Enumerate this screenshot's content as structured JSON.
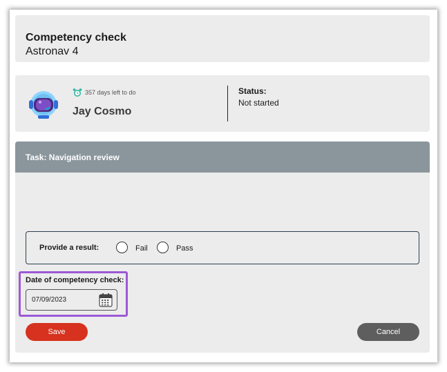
{
  "header": {
    "title": "Competency check",
    "subtitle": "Astronav 4"
  },
  "user": {
    "avatar_icon": "astronaut-helmet-icon",
    "due_icon": "alarm-clock-icon",
    "due_text": "357 days left to do",
    "name": "Jay Cosmo",
    "status_label": "Status:",
    "status_value": "Not started"
  },
  "task": {
    "title": "Task: Navigation review",
    "result_label": "Provide a result:",
    "options": [
      {
        "label": "Fail",
        "selected": false
      },
      {
        "label": "Pass",
        "selected": false
      }
    ],
    "date_label": "Date of competency check:",
    "date_value": "07/09/2023",
    "calendar_icon": "calendar-icon"
  },
  "actions": {
    "save_label": "Save",
    "cancel_label": "Cancel"
  },
  "colors": {
    "task_header": "#8b969c",
    "save": "#d6321f",
    "cancel": "#5e5e5e",
    "highlight": "#9b59d6",
    "alarm": "#2bb5a3"
  }
}
